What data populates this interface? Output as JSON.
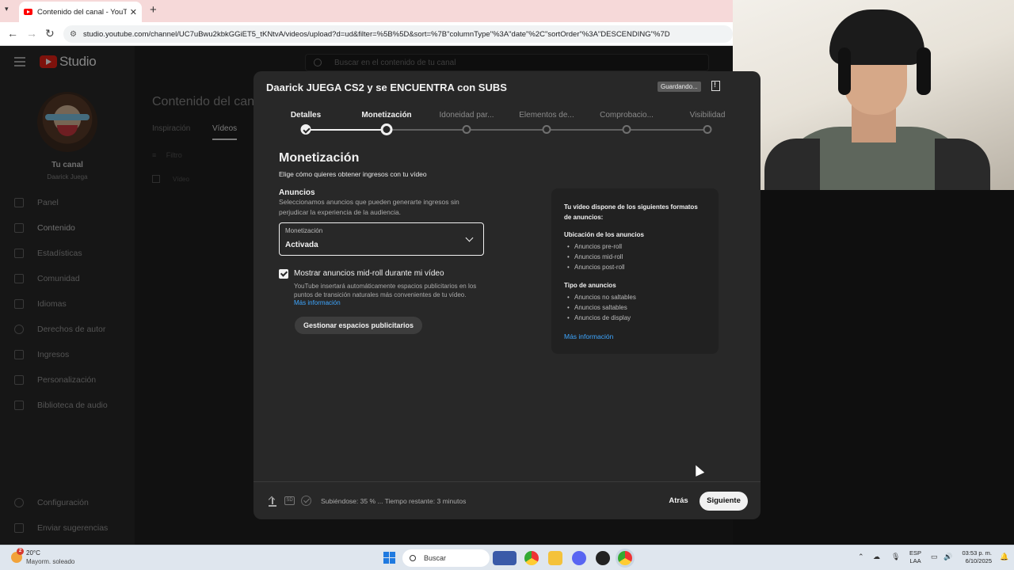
{
  "browser": {
    "tab_title": "Contenido del canal - YouTube",
    "tab_close": "✕",
    "new_tab": "+",
    "url": "studio.youtube.com/channel/UC7uBwu2kbkGGiET5_tKNtvA/videos/upload?d=ud&filter=%5B%5D&sort=%7B\"columnType\"%3A\"date\"%2C\"sortOrder\"%3A\"DESCENDING\"%7D"
  },
  "studio": {
    "logo_text": "Studio",
    "search_placeholder": "Buscar en el contenido de tu canal",
    "channel_label": "Tu canal",
    "channel_name": "Daarick Juega",
    "nav": [
      "Panel",
      "Contenido",
      "Estadísticas",
      "Comunidad",
      "Idiomas",
      "Derechos de autor",
      "Ingresos",
      "Personalización",
      "Biblioteca de audio"
    ],
    "bottom_nav": [
      "Configuración",
      "Enviar sugerencias"
    ],
    "content_title": "Contenido del canal",
    "content_tabs": [
      "Inspiración",
      "Vídeos"
    ],
    "filter_label": "Filtro",
    "col_video": "Vídeo"
  },
  "modal": {
    "title": "Daarick JUEGA CS2 y se ENCUENTRA con SUBS",
    "saving_badge": "Guardando...",
    "steps": [
      "Detalles",
      "Monetización",
      "Idoneidad par...",
      "Elementos de...",
      "Comprobacio...",
      "Visibilidad"
    ],
    "heading": "Monetización",
    "subheading": "Elige cómo quieres obtener ingresos con tu vídeo",
    "ads_heading": "Anuncios",
    "ads_desc": "Seleccionamos anuncios que pueden generarte ingresos sin perjudicar la experiencia de la audiencia.",
    "select_label": "Monetización",
    "select_value": "Activada",
    "checkbox_label": "Mostrar anuncios mid-roll durante mi vídeo",
    "checkbox_checked": true,
    "checkbox_desc": "YouTube insertará automáticamente espacios publicitarios en los puntos de transición naturales más convenientes de tu vídeo.",
    "more_info": "Más información",
    "manage_button": "Gestionar espacios publicitarios",
    "info": {
      "title": "Tu vídeo dispone de los siguientes formatos de anuncios:",
      "placement_heading": "Ubicación de los anuncios",
      "placements": [
        "Anuncios pre-roll",
        "Anuncios mid-roll",
        "Anuncios post-roll"
      ],
      "type_heading": "Tipo de anuncios",
      "types": [
        "Anuncios no saltables",
        "Anuncios saltables",
        "Anuncios de display"
      ],
      "link": "Más información"
    },
    "footer": {
      "sd_badge": "SD",
      "status": "Subiéndose: 35 % ... Tiempo restante: 3 minutos",
      "upload_progress_percent": 35,
      "back_button": "Atrás",
      "next_button": "Siguiente"
    }
  },
  "taskbar": {
    "weather_temp": "20°C",
    "weather_desc": "Mayorm. soleado",
    "weather_badge": "2",
    "search_label": "Buscar",
    "lang_top": "ESP",
    "lang_bottom": "LAA",
    "time": "03:53 p. m.",
    "date": "6/10/2025"
  },
  "colors": {
    "accent_link": "#3ea6ff",
    "youtube_red": "#ff0000",
    "modal_bg": "#282828"
  }
}
